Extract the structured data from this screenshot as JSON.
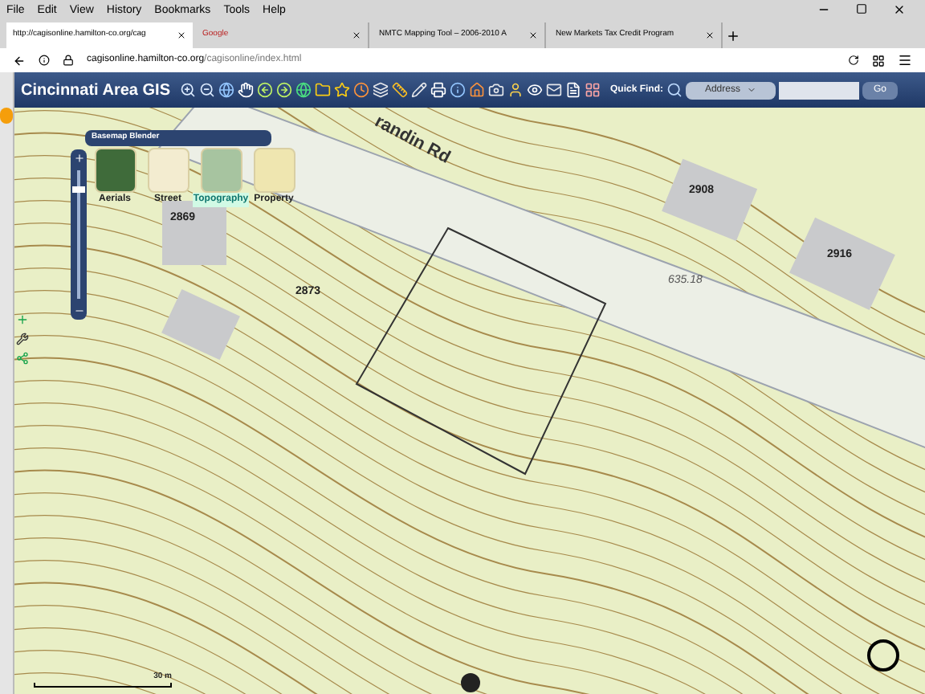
{
  "menu_bar": [
    "File",
    "Edit",
    "View",
    "History",
    "Bookmarks",
    "Tools",
    "Help"
  ],
  "tabs": [
    {
      "label": "http://cagisonline.hamilton-co.org/cag",
      "selected": true
    },
    {
      "label": "Google",
      "selected": false
    },
    {
      "label": "NMTC Mapping Tool – 2006-2010 A",
      "selected": false
    },
    {
      "label": "New Markets Tax Credit Program",
      "selected": false
    }
  ],
  "address_bar": {
    "url_host": "cagisonline.hamilton-co.org",
    "url_path": "/cagisonline/index.html"
  },
  "app_toolbar": {
    "title": "Cincinnati Area GIS",
    "quick_find_label": "Quick Find:",
    "search_type": "Address",
    "go_button": "Go"
  },
  "basemap_blender": {
    "title": "Basemap Blender",
    "options": [
      {
        "label": "Aerials",
        "selected": false
      },
      {
        "label": "Street",
        "selected": false
      },
      {
        "label": "Topography",
        "selected": true
      },
      {
        "label": "Property",
        "selected": false
      }
    ]
  },
  "zoom_slider": {
    "level": 0.88
  },
  "map_labels": [
    {
      "text": "randin Rd",
      "kind": "road"
    },
    {
      "text": "2908",
      "kind": "parcel"
    },
    {
      "text": "2916",
      "kind": "parcel"
    },
    {
      "text": "2869",
      "kind": "parcel"
    },
    {
      "text": "2873",
      "kind": "parcel"
    },
    {
      "text": "635.18",
      "kind": "elevation"
    }
  ],
  "scale_bar": {
    "label": "30 m"
  }
}
